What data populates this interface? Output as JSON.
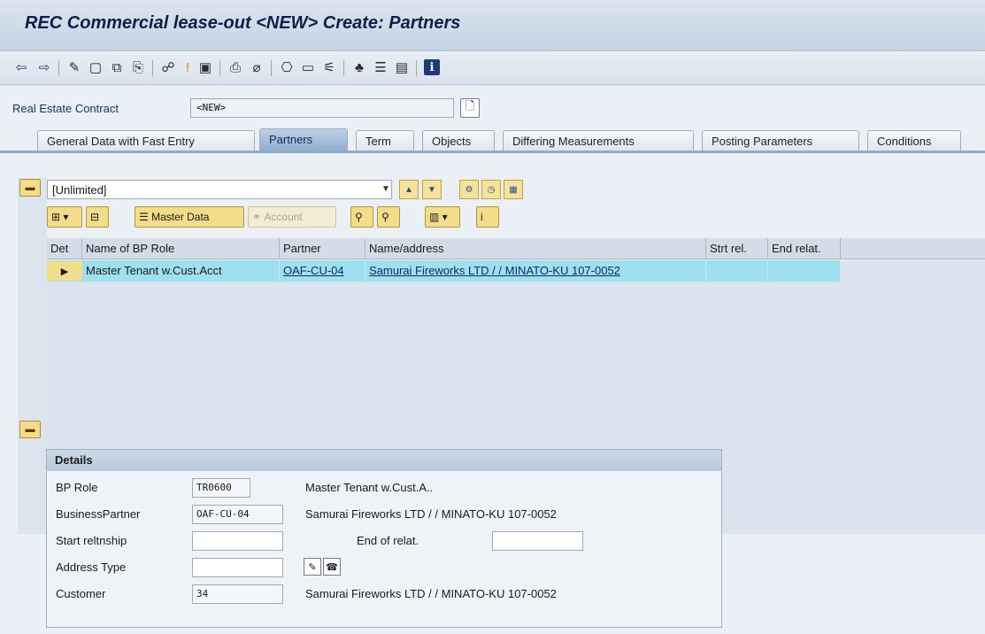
{
  "window": {
    "title": "REC Commercial lease-out <NEW> Create: Partners"
  },
  "toolbar_icons": [
    "back-icon",
    "forward-icon",
    "edit-icon",
    "create-icon",
    "copy-icon",
    "display-icon",
    "relations-icon",
    "warning-icon",
    "save-icon",
    "check-icon",
    "print-icon",
    "link-icon",
    "layout-icon",
    "history-icon",
    "hierarchy-icon",
    "report-icon",
    "window-icon",
    "info-icon"
  ],
  "header": {
    "contract_label": "Real Estate Contract",
    "contract_value": "<NEW>"
  },
  "tabs": [
    {
      "label": "General Data with Fast Entry"
    },
    {
      "label": "Partners"
    },
    {
      "label": "Term"
    },
    {
      "label": "Objects"
    },
    {
      "label": "Differing Measurements"
    },
    {
      "label": "Posting Parameters"
    },
    {
      "label": "Conditions"
    }
  ],
  "filter": {
    "value": "[Unlimited]"
  },
  "grid_toolbar": {
    "master_data": "Master Data",
    "account": "Account"
  },
  "grid": {
    "columns": [
      "Det",
      "Name of BP Role",
      "Partner",
      "Name/address",
      "Strt rel.",
      "End relat."
    ],
    "rows": [
      {
        "role": "Master Tenant w.Cust.Acct",
        "partner": "OAF-CU-04",
        "address": "Samurai Fireworks LTD / / MINATO-KU 107-0052",
        "start": "",
        "end": ""
      }
    ]
  },
  "details": {
    "title": "Details",
    "bp_role_label": "BP Role",
    "bp_role_value": "TR0600",
    "bp_role_text": "Master Tenant w.Cust.A..",
    "bp_label": "BusinessPartner",
    "bp_value": "OAF-CU-04",
    "bp_text": "Samurai Fireworks LTD / / MINATO-KU 107-0052",
    "start_label": "Start reltnship",
    "start_value": "",
    "end_label": "End of relat.",
    "end_value": "",
    "addr_type_label": "Address Type",
    "addr_type_value": "",
    "customer_label": "Customer",
    "customer_value": "34",
    "customer_text": "Samurai Fireworks LTD / / MINATO-KU 107-0052"
  }
}
